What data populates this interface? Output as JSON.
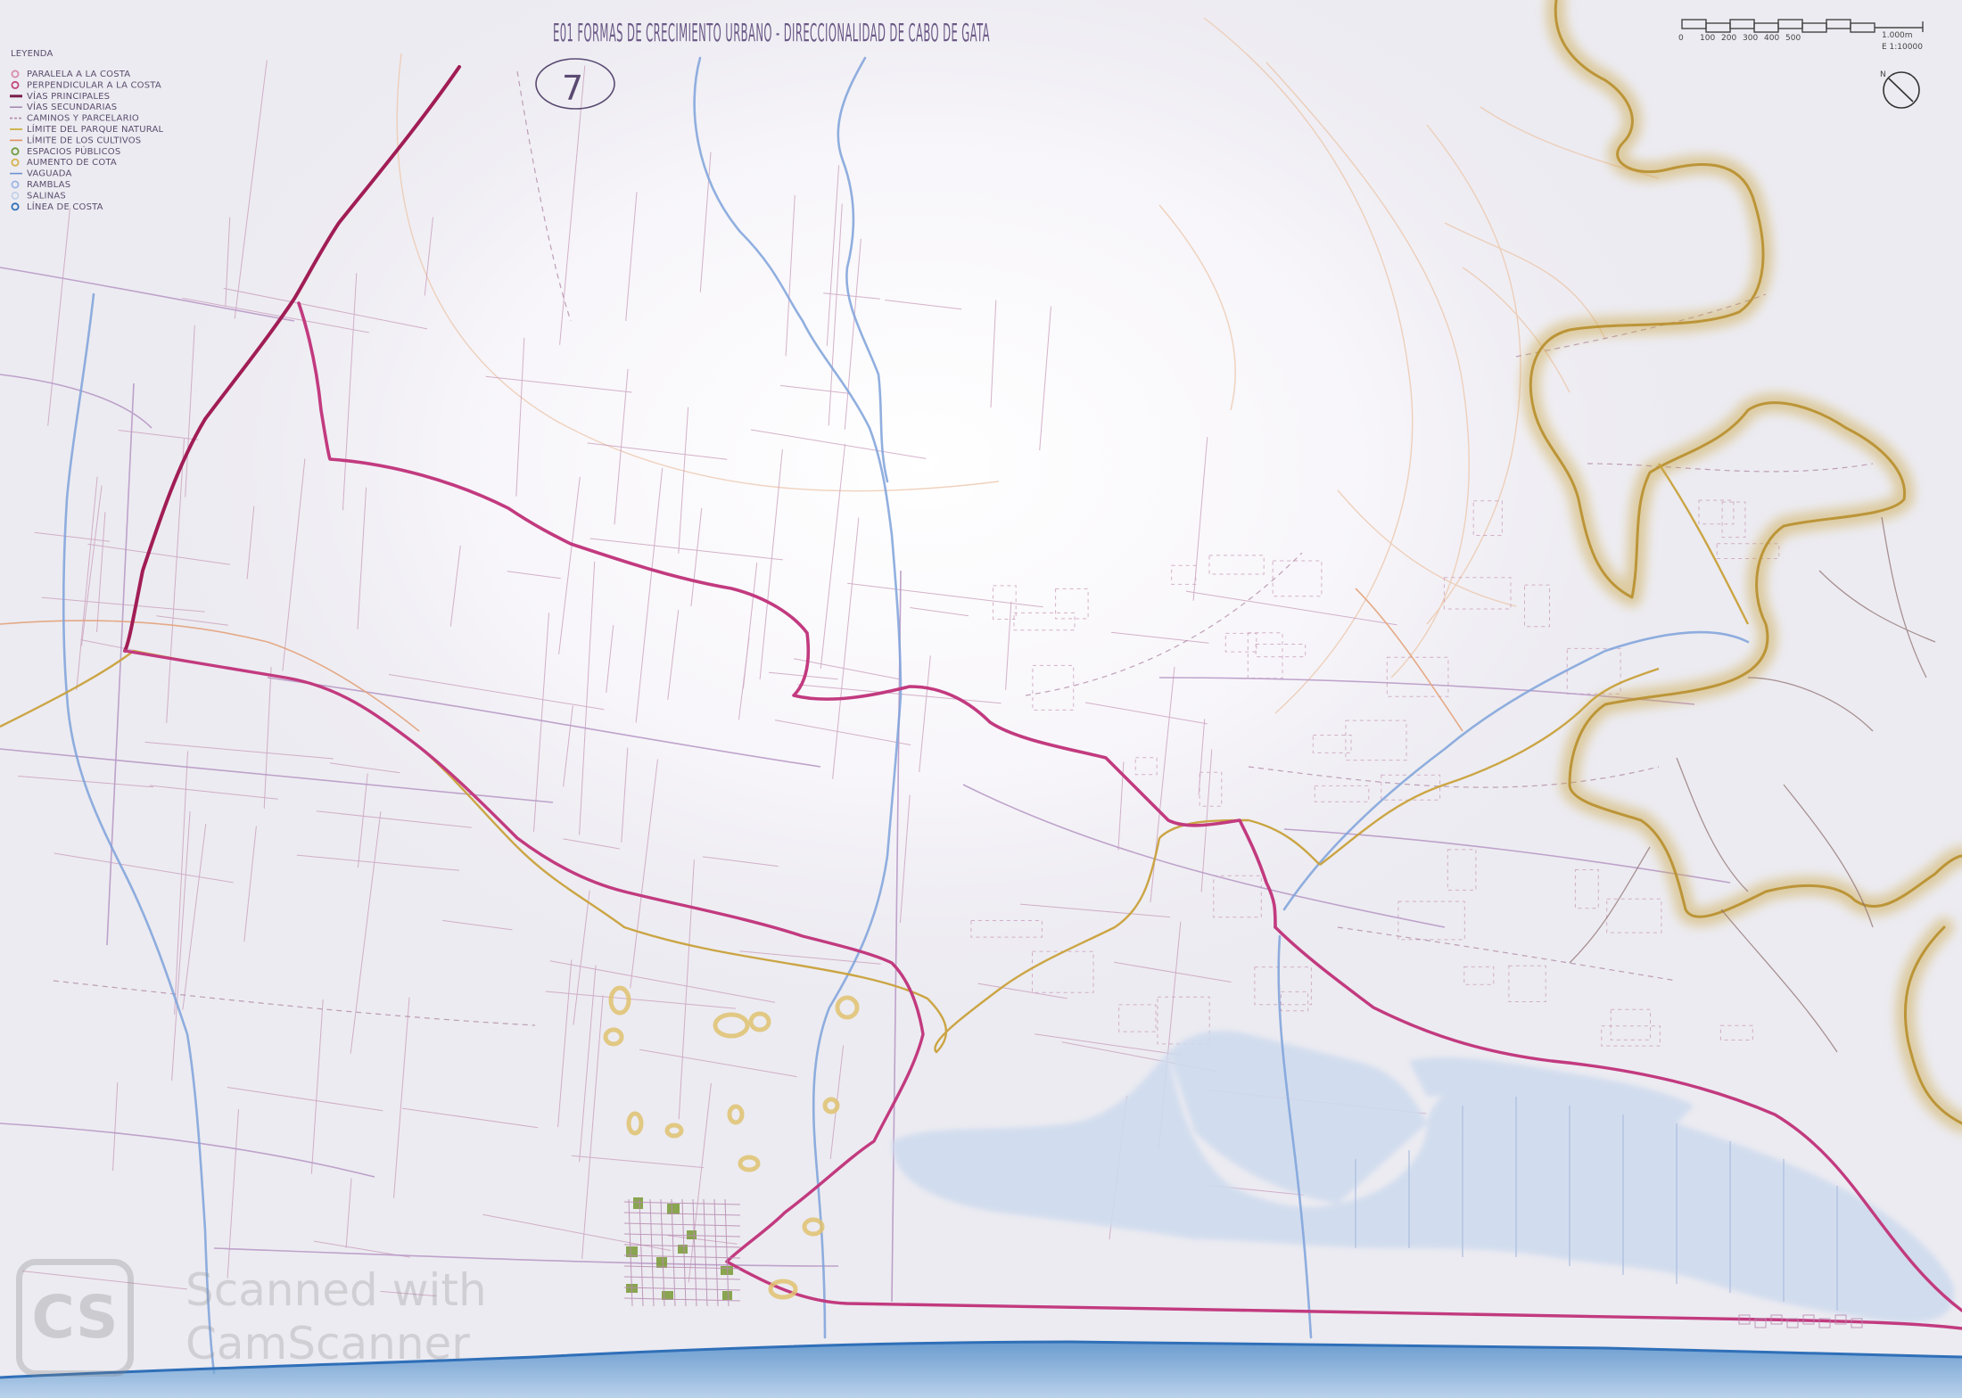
{
  "title": "E01 FORMAS DE CRECIMIENTO URBANO - DIRECCIONALIDAD DE CABO DE GATA",
  "sheet_number": "7",
  "legend": {
    "heading": "LEYENDA",
    "items": [
      {
        "label": "PARALELA A LA COSTA",
        "color": "#d98bb0",
        "symbol": "dot"
      },
      {
        "label": "PERPENDICULAR A LA COSTA",
        "color": "#c2477e",
        "symbol": "dot"
      },
      {
        "label": "VÍAS PRINCIPALES",
        "color": "#7a1f4d",
        "symbol": "thick-line"
      },
      {
        "label": "VÍAS SECUNDARIAS",
        "color": "#a58ab4",
        "symbol": "line"
      },
      {
        "label": "CAMINOS Y PARCELARIO",
        "color": "#b08aa8",
        "symbol": "dashed-line"
      },
      {
        "label": "LÍMITE DEL PARQUE NATURAL",
        "color": "#c9a82c",
        "symbol": "line"
      },
      {
        "label": "LÍMITE DE LOS CULTIVOS",
        "color": "#e0905e",
        "symbol": "line"
      },
      {
        "label": "ESPACIOS PÚBLICOS",
        "color": "#6f9b3a",
        "symbol": "dot"
      },
      {
        "label": "AUMENTO DE COTA",
        "color": "#d6b24a",
        "symbol": "dot"
      },
      {
        "label": "VAGUADA",
        "color": "#6f8fd0",
        "symbol": "line"
      },
      {
        "label": "RAMBLAS",
        "color": "#9db6e4",
        "symbol": "dot"
      },
      {
        "label": "SALINAS",
        "color": "#c4d2ea",
        "symbol": "dot"
      },
      {
        "label": "LÍNEA DE COSTA",
        "color": "#2f6fb8",
        "symbol": "dot"
      }
    ]
  },
  "scale_bar": {
    "ticks": [
      "0",
      "100",
      "200",
      "300",
      "400",
      "500"
    ],
    "end_label": "1.000m",
    "ratio": "E 1:10000"
  },
  "north_arrow": {
    "label": "N"
  },
  "watermark": {
    "logo": "CS",
    "line1": "Scanned with",
    "line2": "CamScanner"
  },
  "colors": {
    "main_road": "#c23a7f",
    "main_road_dark": "#a11d55",
    "secondary_road": "#b99ac6",
    "park_limit": "#c9a13a",
    "crop_limit": "#e3a27a",
    "rambla": "#7ea2da",
    "salinas": "#d3def0",
    "coast": "#3f82c4",
    "public_space": "#7f9e3e",
    "raised_ground": "#e0c270",
    "mountain_ochre": "#c9a440"
  }
}
